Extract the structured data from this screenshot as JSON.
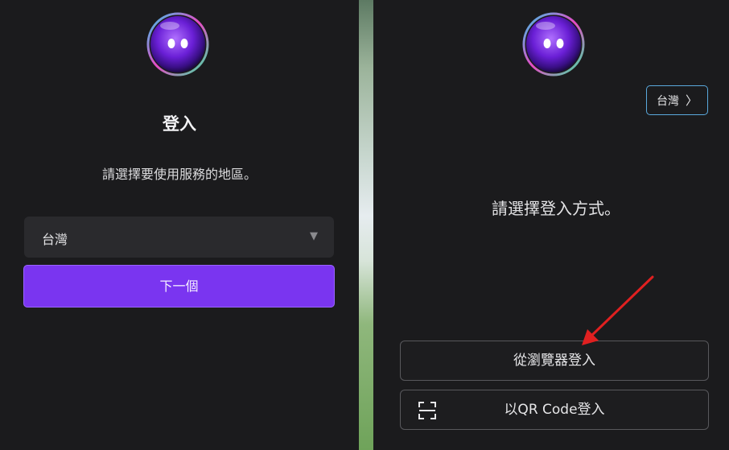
{
  "left": {
    "title": "登入",
    "region_prompt": "請選擇要使用服務的地區。",
    "region_select": {
      "value": "台灣"
    },
    "next_label": "下一個"
  },
  "right": {
    "region_chip": "台灣",
    "method_prompt": "請選擇登入方式。",
    "browser_login_label": "從瀏覽器登入",
    "qr_login_label": "以QR Code登入"
  },
  "icons": {
    "mascot": "purple-bubble-mascot-icon",
    "select_caret": "caret-down-icon",
    "chip_chevron": "chevron-right-icon",
    "qr": "qr-scan-icon",
    "annotation": "red-arrow-annotation"
  },
  "colors": {
    "accent": "#7a35f0",
    "panel_bg": "#1b1b1d",
    "chip_border": "#5aa9dd",
    "annotation": "#e02020"
  }
}
